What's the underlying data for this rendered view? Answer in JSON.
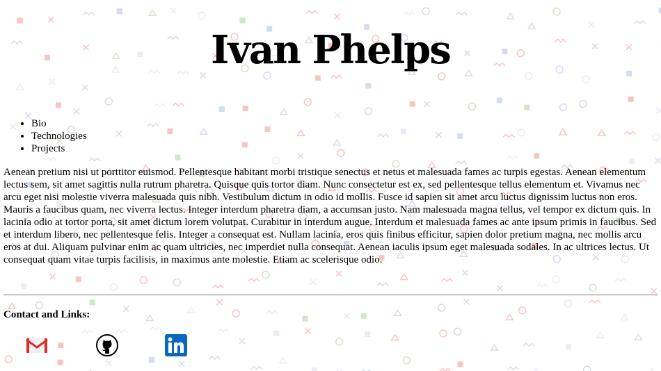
{
  "header": {
    "name": "Ivan Phelps"
  },
  "nav": {
    "items": [
      "Bio",
      "Technologies",
      "Projects"
    ]
  },
  "bio": {
    "text": "Aenean pretium nisi ut porttitor euismod. Pellentesque habitant morbi tristique senectus et netus et malesuada fames ac turpis egestas. Aenean elementum lectus sem, sit amet sagittis nulla rutrum pharetra. Quisque quis tortor diam. Nunc consectetur est ex, sed pellentesque tellus elementum et. Vivamus nec arcu eget nisi molestie viverra malesuada quis nibh. Vestibulum dictum in odio id mollis. Fusce id sapien sit amet arcu luctus dignissim luctus non eros. Mauris a faucibus quam, nec viverra lectus. Integer interdum pharetra diam, a accumsan justo. Nam malesuada magna tellus, vel tempor ex dictum quis. In lacinia odio at tortor porta, sit amet dictum lorem volutpat. Curabitur in interdum augue. Interdum et malesuada fames ac ante ipsum primis in faucibus. Sed et interdum libero, nec pellentesque felis. Integer a consequat est. Nullam lacinia, eros quis finibus efficitur, sapien dolor pretium magna, nec mollis arcu eros at dui. Aliquam pulvinar enim ac quam ultricies, nec imperdiet nulla consequat. Aenean iaculis ipsum eget malesuada sodales. In ac ultrices lectus. Ut consequat quam vitae turpis facilisis, in maximus ante molestie. Etiam ac scelerisque odio."
  },
  "contact": {
    "heading": "Contact and Links:",
    "links": [
      {
        "icon": "gmail-icon"
      },
      {
        "icon": "github-icon"
      },
      {
        "icon": "linkedin-icon"
      }
    ]
  },
  "colors": {
    "text": "#000000",
    "linkedin_blue": "#0a66c2",
    "gmail_red": "#d93025",
    "pattern": [
      "#f4b6b6",
      "#c9d3e8",
      "#c8dcc0",
      "#e6e6f2"
    ]
  }
}
